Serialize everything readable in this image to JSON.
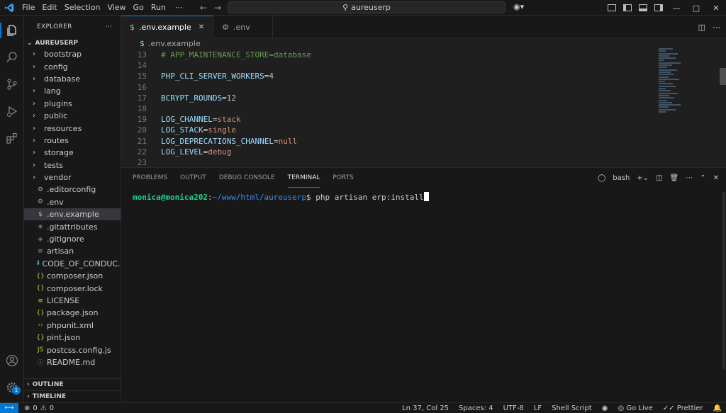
{
  "menu": [
    "File",
    "Edit",
    "Selection",
    "View",
    "Go",
    "Run",
    "⋯"
  ],
  "command_center": {
    "text": "aureuserp"
  },
  "explorer": {
    "title": "EXPLORER",
    "project": "AUREUSERP",
    "folders": [
      "bootstrap",
      "config",
      "database",
      "lang",
      "plugins",
      "public",
      "resources",
      "routes",
      "storage",
      "tests",
      "vendor"
    ],
    "files": [
      {
        "name": ".editorconfig",
        "icon": "⚙",
        "color": "#9d9d9d"
      },
      {
        "name": ".env",
        "icon": "⚙",
        "color": "#9d9d9d"
      },
      {
        "name": ".env.example",
        "icon": "$",
        "color": "#89d185",
        "selected": true
      },
      {
        "name": ".gitattributes",
        "icon": "◈",
        "color": "#6d8086"
      },
      {
        "name": ".gitignore",
        "icon": "◈",
        "color": "#6d8086"
      },
      {
        "name": "artisan",
        "icon": "≡",
        "color": "#9d9d9d"
      },
      {
        "name": "CODE_OF_CONDUC...",
        "icon": "⬇",
        "color": "#519aba"
      },
      {
        "name": "composer.json",
        "icon": "{}",
        "color": "#cbcb41"
      },
      {
        "name": "composer.lock",
        "icon": "{}",
        "color": "#cbcb41"
      },
      {
        "name": "LICENSE",
        "icon": "≡",
        "color": "#cbcb41"
      },
      {
        "name": "package.json",
        "icon": "{}",
        "color": "#cbcb41"
      },
      {
        "name": "phpunit.xml",
        "icon": "‹›",
        "color": "#e37933"
      },
      {
        "name": "pint.json",
        "icon": "{}",
        "color": "#cbcb41"
      },
      {
        "name": "postcss.config.js",
        "icon": "JS",
        "color": "#cbcb41"
      },
      {
        "name": "README.md",
        "icon": "ⓘ",
        "color": "#519aba"
      }
    ],
    "outline": "OUTLINE",
    "timeline": "TIMELINE"
  },
  "tabs": [
    {
      "label": ".env.example",
      "icon": "$",
      "active": true
    },
    {
      "label": ".env",
      "icon": "⚙",
      "active": false
    }
  ],
  "breadcrumb": {
    "icon": "$",
    "label": ".env.example"
  },
  "code_lines": [
    {
      "n": 13,
      "tokens": [
        [
          "comment",
          "# APP_MAINTENANCE_STORE=database"
        ]
      ]
    },
    {
      "n": 14,
      "tokens": []
    },
    {
      "n": 15,
      "tokens": [
        [
          "key",
          "PHP_CLI_SERVER_WORKERS"
        ],
        [
          "op",
          "="
        ],
        [
          "num",
          "4"
        ]
      ]
    },
    {
      "n": 16,
      "tokens": []
    },
    {
      "n": 17,
      "tokens": [
        [
          "key",
          "BCRYPT_ROUNDS"
        ],
        [
          "op",
          "="
        ],
        [
          "num",
          "12"
        ]
      ]
    },
    {
      "n": 18,
      "tokens": []
    },
    {
      "n": 19,
      "tokens": [
        [
          "key",
          "LOG_CHANNEL"
        ],
        [
          "op",
          "="
        ],
        [
          "val",
          "stack"
        ]
      ]
    },
    {
      "n": 20,
      "tokens": [
        [
          "key",
          "LOG_STACK"
        ],
        [
          "op",
          "="
        ],
        [
          "val",
          "single"
        ]
      ]
    },
    {
      "n": 21,
      "tokens": [
        [
          "key",
          "LOG_DEPRECATIONS_CHANNEL"
        ],
        [
          "op",
          "="
        ],
        [
          "val",
          "null"
        ]
      ]
    },
    {
      "n": 22,
      "tokens": [
        [
          "key",
          "LOG_LEVEL"
        ],
        [
          "op",
          "="
        ],
        [
          "val",
          "debug"
        ]
      ]
    },
    {
      "n": 23,
      "tokens": []
    }
  ],
  "panel": {
    "tabs": [
      "PROBLEMS",
      "OUTPUT",
      "DEBUG CONSOLE",
      "TERMINAL",
      "PORTS"
    ],
    "active_tab": "TERMINAL",
    "shell": "bash"
  },
  "terminal": {
    "user": "monica@monica202",
    "sep": ":",
    "path": "~/www/html/aureuserp",
    "dollar": "$ ",
    "command": "php artisan erp:install"
  },
  "status": {
    "errors": "0",
    "warnings": "0",
    "position": "Ln 37, Col 25",
    "spaces": "Spaces: 4",
    "encoding": "UTF-8",
    "eol": "LF",
    "language": "Shell Script",
    "golive": "Go Live",
    "prettier": "Prettier"
  },
  "colors": {
    "accent": "#0078d4",
    "background": "#1f1f1f",
    "sidebar": "#181818"
  },
  "badge_count": "1"
}
